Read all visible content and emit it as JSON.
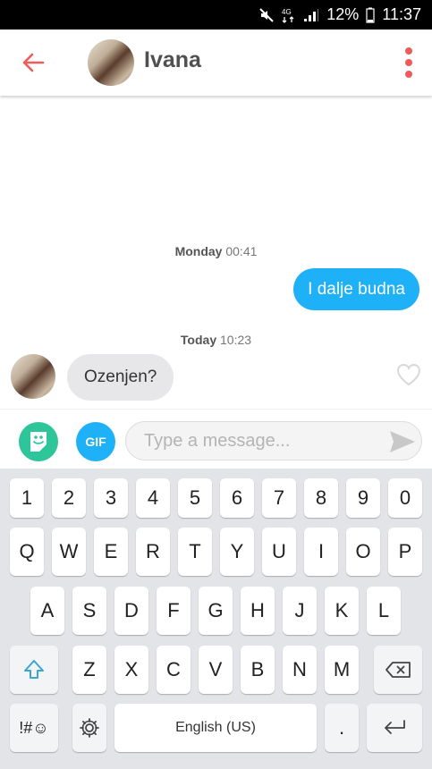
{
  "status_bar": {
    "battery": "12%",
    "time": "11:37",
    "network": "4G"
  },
  "header": {
    "contact_name": "Ivana"
  },
  "chat": {
    "timestamps": [
      {
        "day": "Monday",
        "time": "00:41"
      },
      {
        "day": "Today",
        "time": "10:23"
      }
    ],
    "outgoing_message": "I dalje budna",
    "incoming_message": "Ozenjen?"
  },
  "input": {
    "gif_label": "GIF",
    "placeholder": "Type a message..."
  },
  "keyboard": {
    "row1": [
      "1",
      "2",
      "3",
      "4",
      "5",
      "6",
      "7",
      "8",
      "9",
      "0"
    ],
    "row2": [
      "Q",
      "W",
      "E",
      "R",
      "T",
      "Y",
      "U",
      "I",
      "O",
      "P"
    ],
    "row3": [
      "A",
      "S",
      "D",
      "F",
      "G",
      "H",
      "J",
      "K",
      "L"
    ],
    "row4": [
      "Z",
      "X",
      "C",
      "V",
      "B",
      "N",
      "M"
    ],
    "symbols_label": "!#☺",
    "space_label": "English (US)",
    "period_label": "."
  },
  "colors": {
    "accent_red": "#f05a5a",
    "accent_blue": "#1fb1f7",
    "sticker_green": "#2ec59a"
  }
}
